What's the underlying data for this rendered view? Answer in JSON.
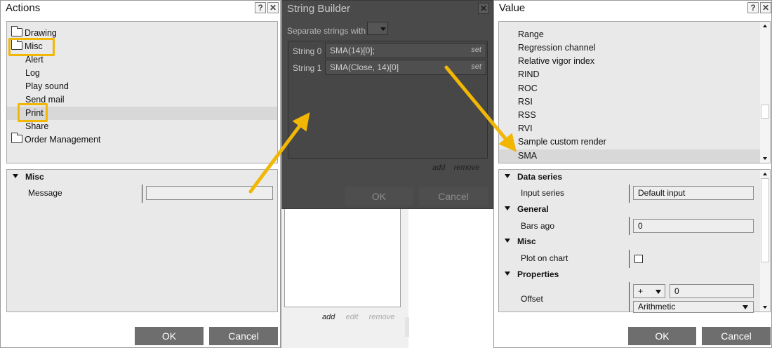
{
  "actions": {
    "title": "Actions",
    "help_label": "?",
    "close_label": "✕",
    "tree": [
      {
        "label": "Drawing",
        "type": "folder"
      },
      {
        "label": "Misc",
        "type": "folder-open"
      },
      {
        "label": "Alert",
        "type": "item"
      },
      {
        "label": "Log",
        "type": "item"
      },
      {
        "label": "Play sound",
        "type": "item"
      },
      {
        "label": "Send mail",
        "type": "item"
      },
      {
        "label": "Print",
        "type": "item",
        "selected": true
      },
      {
        "label": "Share",
        "type": "item"
      },
      {
        "label": "Order Management",
        "type": "folder"
      }
    ],
    "props": {
      "category": "Misc",
      "message_label": "Message",
      "message_value": ""
    },
    "ok_label": "OK",
    "cancel_label": "Cancel"
  },
  "string_builder": {
    "title": "String Builder",
    "close_label": "✕",
    "separate_label": "Separate strings with",
    "separator_value": "",
    "strings": [
      {
        "label": "String 0",
        "value": "SMA(14)[0];",
        "set": "set"
      },
      {
        "label": "String 1",
        "value": "SMA(Close, 14)[0]",
        "set": "set"
      }
    ],
    "add_label": "add",
    "remove_label": "remove",
    "ok_label": "OK",
    "cancel_label": "Cancel"
  },
  "background_list": {
    "add_label": "add",
    "edit_label": "edit",
    "remove_label": "remove"
  },
  "value": {
    "title": "Value",
    "help_label": "?",
    "close_label": "✕",
    "list": [
      "Range",
      "Regression channel",
      "Relative vigor index",
      "RIND",
      "ROC",
      "RSI",
      "RSS",
      "RVI",
      "Sample custom render",
      "SMA"
    ],
    "selected": "SMA",
    "props": {
      "data_series": {
        "category": "Data series",
        "input_series_label": "Input series",
        "input_series_value": "Default input"
      },
      "general": {
        "category": "General",
        "bars_ago_label": "Bars ago",
        "bars_ago_value": "0"
      },
      "misc": {
        "category": "Misc",
        "plot_on_chart_label": "Plot on chart",
        "plot_on_chart_checked": false
      },
      "properties": {
        "category": "Properties",
        "offset_label": "Offset",
        "offset_op": "+",
        "offset_value": "0",
        "offset_type": "Arithmetic"
      }
    },
    "ok_label": "OK",
    "cancel_label": "Cancel"
  },
  "colors": {
    "highlight": "#f2b705",
    "arrow": "#f2b705",
    "button": "#6e6e6e",
    "panel": "#e9e9e9",
    "overlay": "#4a4a4a"
  }
}
